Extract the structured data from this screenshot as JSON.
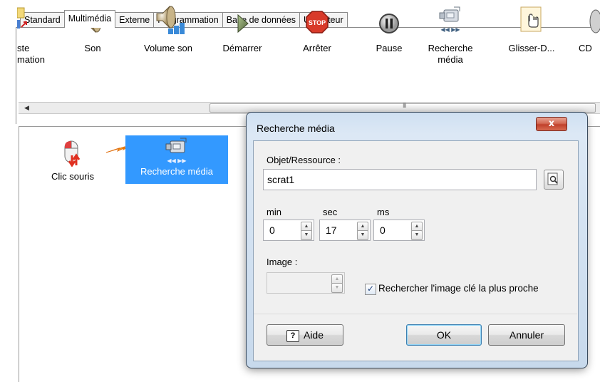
{
  "tabs": [
    "Standard",
    "Multimédia",
    "Externe",
    "Programmation",
    "Base de données",
    "Utilisateur"
  ],
  "tabs_active": "Multimédia",
  "toolbar": {
    "item_partial": "ste\nmation",
    "son": "Son",
    "volume_son": "Volume son",
    "demarrer": "Démarrer",
    "arreter": "Arrêter",
    "stop_text": "STOP",
    "pause": "Pause",
    "recherche_media": "Recherche\nmédia",
    "glisser": "Glisser-D...",
    "cd": "CD"
  },
  "scrollbar": {
    "grip": "III"
  },
  "workspace": {
    "node_clic": "Clic souris",
    "node_recherche": "Recherche média"
  },
  "dialog": {
    "title": "Recherche média",
    "close": "x",
    "objet_label": "Objet/Ressource :",
    "objet_value": "scrat1",
    "min_label": "min",
    "sec_label": "sec",
    "ms_label": "ms",
    "min_value": "0",
    "sec_value": "17",
    "ms_value": "0",
    "image_label": "Image :",
    "image_value": "",
    "checkbox_label": "Rechercher l'image clé la plus proche",
    "checkbox_checked": true,
    "help_icon": "?",
    "help_label": "Aide",
    "ok_label": "OK",
    "cancel_label": "Annuler"
  }
}
